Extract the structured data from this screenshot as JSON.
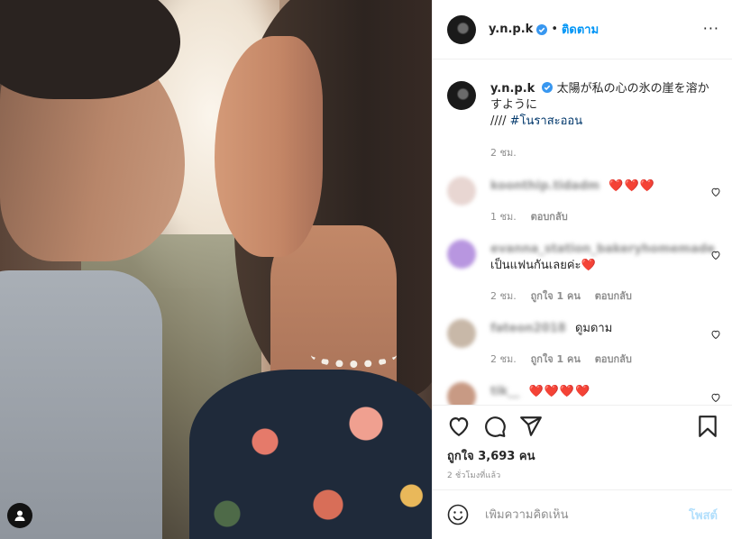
{
  "header": {
    "username": "y.n.p.k",
    "separator": "•",
    "follow_label": "ติดตาม",
    "more_label": "···"
  },
  "caption": {
    "username": "y.n.p.k",
    "text": "太陽が私の心の氷の崖を溶かすように",
    "line2_prefix": "//// ",
    "hashtag": "#โนราสะออน",
    "time": "2 ชม."
  },
  "comments": [
    {
      "username": "koonthip.tidadm",
      "text": "❤️❤️❤️",
      "time": "1 ชม.",
      "likes": "",
      "reply": "ตอบกลับ",
      "avatar_color": "#e8d6d2"
    },
    {
      "username": "evanna_station_bakeryhomemade",
      "text": "เป็นแฟนกันเลยค่ะ❤️",
      "time": "2 ชม.",
      "likes": "ถูกใจ 1 คน",
      "reply": "ตอบกลับ",
      "avatar_color": "#b896e0"
    },
    {
      "username": "fateon2018",
      "text": "ดูมดาม",
      "time": "2 ชม.",
      "likes": "ถูกใจ 1 คน",
      "reply": "ตอบกลับ",
      "avatar_color": "#c8b8a8"
    },
    {
      "username": "tik__",
      "text": "❤️❤️❤️❤️",
      "time": "",
      "likes": "",
      "reply": "",
      "avatar_color": "#c89a84"
    }
  ],
  "actions": {
    "likes_text": "ถูกใจ 3,693 คน",
    "post_time": "2 ชั่วโมงที่แล้ว"
  },
  "add_comment": {
    "placeholder": "เพิ่มความคิดเห็น",
    "post_label": "โพสต์"
  },
  "colors": {
    "link_blue": "#0095f6",
    "hashtag": "#00376b",
    "muted": "#8e8e8e",
    "heart_red": "#ed4956",
    "post_disabled": "#b2dffc"
  },
  "icons": [
    "verified-badge-icon",
    "heart-icon",
    "comment-icon",
    "share-icon",
    "bookmark-icon",
    "emoji-icon",
    "user-tag-icon",
    "more-options-icon"
  ]
}
